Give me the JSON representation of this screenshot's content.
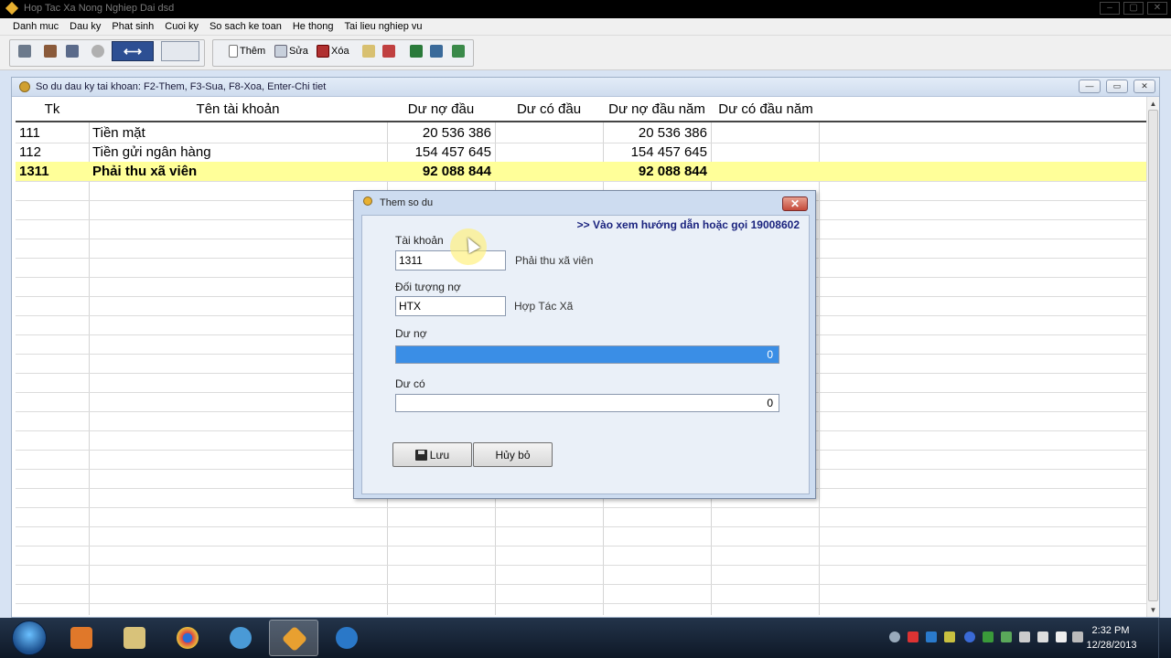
{
  "window": {
    "title": "Hop Tac Xa Nong Nghiep Dai dsd",
    "controls": [
      "–",
      "▢",
      "✕"
    ]
  },
  "menu": [
    "Danh muc",
    "Dau ky",
    "Phat sinh",
    "Cuoi ky",
    "So sach ke toan",
    "He thong",
    "Tai lieu nghiep vu"
  ],
  "toolbar": {
    "add_label": "Thêm",
    "edit_label": "Sửa",
    "delete_label": "Xóa"
  },
  "child_window": {
    "title": "So du dau ky tai khoan: F2-Them, F3-Sua, F8-Xoa, Enter-Chi tiet",
    "controls": [
      "—",
      "▭",
      "✕"
    ]
  },
  "grid": {
    "columns": [
      "Tk",
      "Tên tài khoản",
      "Dư nợ đầu",
      "Dư có đầu",
      "Dư nợ đầu năm",
      "Dư có đầu năm"
    ],
    "rows": [
      {
        "tk": "111",
        "name": "Tiền mặt",
        "du_no_dau": "20 536 386",
        "du_co_dau": "",
        "du_no_dau_nam": "20 536 386",
        "du_co_dau_nam": ""
      },
      {
        "tk": "112",
        "name": "Tiền gửi ngân hàng",
        "du_no_dau": "154 457 645",
        "du_co_dau": "",
        "du_no_dau_nam": "154 457 645",
        "du_co_dau_nam": ""
      },
      {
        "tk": "1311",
        "name": "Phải thu xã viên",
        "du_no_dau": "92 088 844",
        "du_co_dau": "",
        "du_no_dau_nam": "92 088 844",
        "du_co_dau_nam": ""
      }
    ],
    "selected_row": 2
  },
  "dialog": {
    "title": "Them so du",
    "help_text": ">> Vào xem hướng dẫn hoặc gọi 19008602",
    "account_label": "Tài khoản",
    "account_value": "1311",
    "account_desc": "Phải thu xã viên",
    "debtor_label": "Đối tượng nợ",
    "debtor_value": "HTX",
    "debtor_desc": "Hợp Tác Xã",
    "debit_label": "Dư nợ",
    "debit_value": "0",
    "credit_label": "Dư có",
    "credit_value": "0",
    "save_label": "Lưu",
    "cancel_label": "Hủy bỏ"
  },
  "taskbar": {
    "time": "2:32 PM",
    "date": "12/28/2013"
  },
  "colors": {
    "selected_row": "#ffff99",
    "focused_field": "#3a8ee6",
    "help_link": "#1a237e",
    "taskbar": "#0e1827"
  }
}
